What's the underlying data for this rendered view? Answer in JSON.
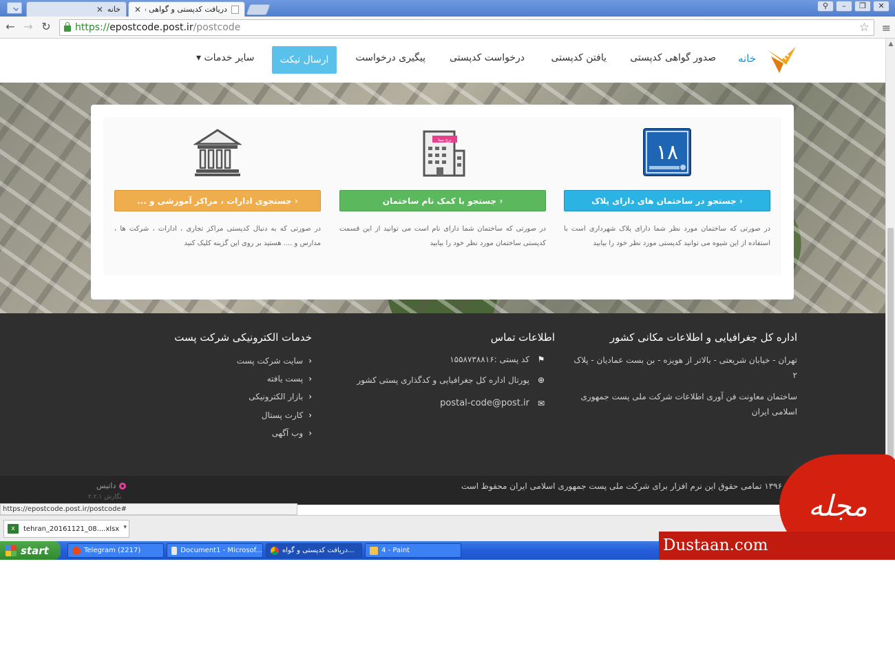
{
  "browser": {
    "tabs": [
      {
        "label": "خانه"
      },
      {
        "label": "دریافت کدپستی و گواهی ش"
      }
    ],
    "url": {
      "scheme": "https://",
      "host": "epostcode.post.ir",
      "path": "/postcode"
    }
  },
  "nav": {
    "home": "خانه",
    "items": [
      "صدور گواهی کدپستی",
      "یافتن کدپستی",
      "درخواست کدپستی",
      "پیگیری درخواست"
    ],
    "ticket": "ارسال تیکت",
    "more": "سایر خدمات"
  },
  "search_cards": [
    {
      "icon": "plaque-icon",
      "plaque_number": "۱۸",
      "button": "جستجو در ساختمان های دارای پلاک",
      "color": "#2ab3e3",
      "desc": "در صورتی که ساختمان مورد نظر شما دارای پلاک شهرداری است با استفاده از این شیوه می توانید کدپستی مورد نظر خود را بیابید"
    },
    {
      "icon": "building-icon",
      "badge": "برج مینا",
      "button": "جستجو با کمک نام ساختمان",
      "color": "#5cb85c",
      "desc": "در صورتی که ساختمان شما دارای نام است می توانید از این قسمت کدپستی ساختمان مورد نظر خود را بیابید"
    },
    {
      "icon": "institution-icon",
      "button": "جستجوی ادارات ، مراکز آموزشی و ...",
      "color": "#f0ad4e",
      "desc": "در صورتی که به دنبال کدپستی مراکز تجاری ، ادارات ، شرکت ها ، مدارس و .... هستید بر روی این گزینه کلیک کنید"
    }
  ],
  "footer": {
    "org": {
      "title": "اداره کل جغرافیایی و اطلاعات مکانی کشور",
      "address": "تهران - خیابان شریعتی - بالاتر از هویزه - بن بست عمادیان - پلاک ۲",
      "building": "ساختمان معاونت فن آوری اطلاعات شرکت ملی پست جمهوری اسلامی ایران"
    },
    "contact": {
      "title": "اطلاعات تماس",
      "postal_code": "کد پستی :۱۵۵۸۷۳۸۸۱۶",
      "portal": "پورتال اداره کل جغرافیایی و کدگذاری پستی کشور",
      "email": "postal-code@post.ir"
    },
    "services": {
      "title": "خدمات الکترونیکی شرکت پست",
      "links": [
        "سایت شرکت پست",
        "پست یافته",
        "بازار الکترونیکی",
        "کارت پستال",
        "وب آگهی"
      ]
    },
    "copyright": "۱۳۹۶ تمامی حقوق این نرم افزار برای شرکت ملی پست جمهوری اسلامی ایران محفوظ است",
    "brand": "داتیس",
    "version": "نگارش ۲.۲.۱"
  },
  "status_url": "https://epostcode.post.ir/postcode#",
  "download": {
    "file": "tehran_20161121_08....xlsx"
  },
  "taskbar": {
    "start": "start",
    "tasks": [
      "Telegram (2217)",
      "Document1 - Microsof...",
      "دریافت کدپستی و گواه...",
      "4 - Paint"
    ]
  },
  "watermark": {
    "site": "Dustaan.com",
    "title": "مجله دوستان"
  }
}
